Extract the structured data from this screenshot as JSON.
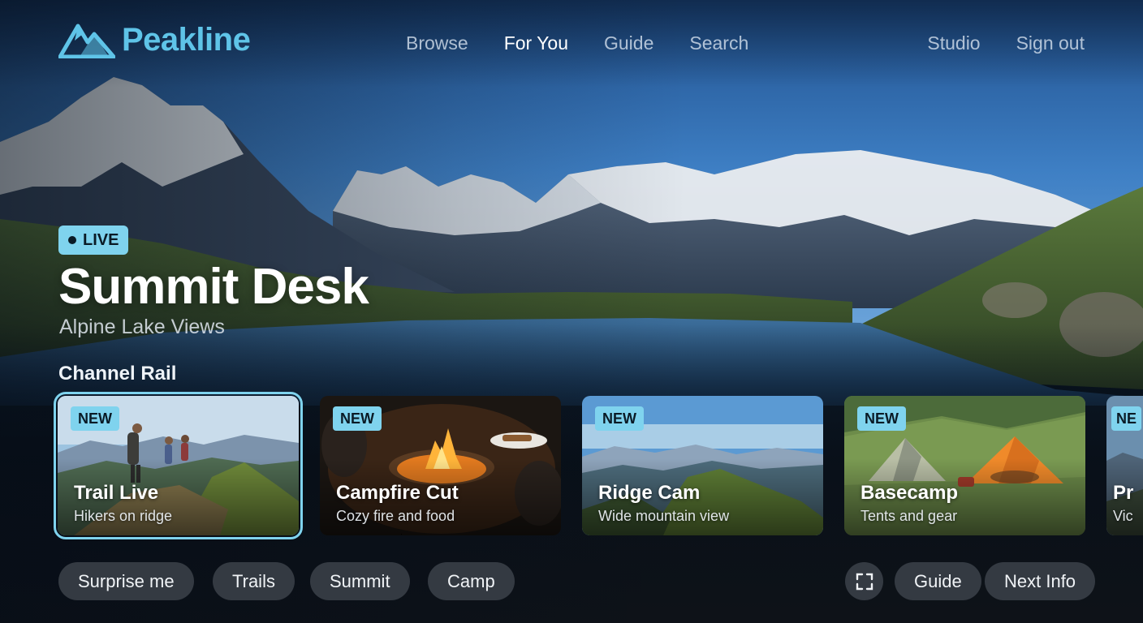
{
  "app": {
    "name": "Peakline",
    "logo_icon": "mountain-logo-icon",
    "accent": "#5fc4e8",
    "badge_color": "#7fd3ee"
  },
  "nav": {
    "items": [
      {
        "label": "Browse",
        "active": false
      },
      {
        "label": "For You",
        "active": true
      },
      {
        "label": "Guide",
        "active": false
      },
      {
        "label": "Search",
        "active": false
      }
    ],
    "right": [
      {
        "label": "Studio"
      },
      {
        "label": "Sign out"
      }
    ]
  },
  "hero": {
    "live_label": "LIVE",
    "title": "Summit Desk",
    "subtitle": "Alpine Lake Views"
  },
  "rail": {
    "title": "Channel Rail",
    "cards": [
      {
        "badge": "NEW",
        "title": "Trail Live",
        "subtitle": "Hikers on ridge",
        "focused": true
      },
      {
        "badge": "NEW",
        "title": "Campfire Cut",
        "subtitle": "Cozy fire and food",
        "focused": false
      },
      {
        "badge": "NEW",
        "title": "Ridge Cam",
        "subtitle": "Wide mountain view",
        "focused": false
      },
      {
        "badge": "NEW",
        "title": "Basecamp",
        "subtitle": "Tents and gear",
        "focused": false
      },
      {
        "badge": "NE",
        "title": "Pr",
        "subtitle": "Vic",
        "focused": false
      }
    ]
  },
  "actions": {
    "left": [
      "Surprise me",
      "Trails",
      "Summit",
      "Camp"
    ],
    "fullscreen_icon": "fullscreen-icon",
    "right": [
      "Guide",
      "Next Info"
    ]
  }
}
